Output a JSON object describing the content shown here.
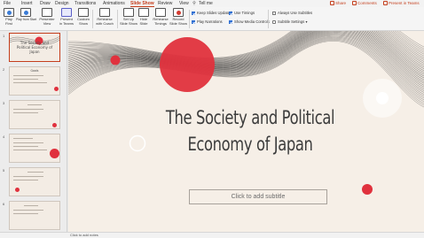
{
  "tabs": [
    "File",
    "Insert",
    "Draw",
    "Design",
    "Transitions",
    "Animations",
    "Slide Show",
    "Review",
    "View",
    "Tell me"
  ],
  "active_tab": "Slide Show",
  "top_actions": {
    "share": "Share",
    "comments": "Comments",
    "present_teams": "Present in Teams"
  },
  "ribbon": {
    "play_first": "Play\nFirst",
    "play_current": "Play from Start",
    "presenter_view": "Presenter\nView",
    "present_teams": "Present\nin Teams",
    "custom_show": "Custom\nShow",
    "rehearse_coach": "Rehearse\nwith Coach",
    "setup": "Set Up\nSlide Show",
    "hide_slide": "Hide\nSlide",
    "rehearse_timings": "Rehearse\nTimings",
    "record": "Record\nSlide Show",
    "keep_updated": "Keep Slides Updated",
    "use_timings": "Use Timings",
    "play_narrations": "Play Narrations",
    "show_media_controls": "Show Media Controls",
    "always_subtitles": "Always Use Subtitles",
    "subtitle_settings": "Subtitle Settings"
  },
  "thumbnails": [
    {
      "num": "1",
      "title": "The Society and Political Economy of Japan"
    },
    {
      "num": "2",
      "title": "Goals"
    },
    {
      "num": "3",
      "title": ""
    },
    {
      "num": "4",
      "title": ""
    },
    {
      "num": "5",
      "title": ""
    },
    {
      "num": "6",
      "title": ""
    }
  ],
  "slide": {
    "title_line1": "The Society and Political",
    "title_line2": "Economy of Japan",
    "subtitle_placeholder": "Click to add subtitle"
  },
  "notes_placeholder": "Click to add notes",
  "colors": {
    "accent": "#c43e1c",
    "dot_red": "#e0313d",
    "slide_bg": "#f6efe7"
  }
}
